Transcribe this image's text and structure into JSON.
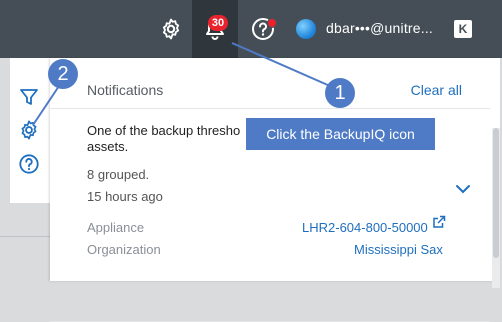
{
  "topbar": {
    "badge_count": "30",
    "user_name": "dbar•••@unitre...",
    "logo_text": "K"
  },
  "panel": {
    "title": "Notifications",
    "clear_all": "Clear all"
  },
  "notification": {
    "message": "One of the backup thresho assets.",
    "grouped": "8 grouped.",
    "time": "15 hours ago",
    "appliance_label": "Appliance",
    "appliance_value": "LHR2-604-800-50000",
    "organization_label": "Organization",
    "organization_value": "Mississippi Sax"
  },
  "annotations": {
    "tooltip": "Click the BackupIQ icon",
    "callout_1": "1",
    "callout_2": "2"
  },
  "colors": {
    "topbar": "#454e56",
    "badge": "#e8232d",
    "link": "#1f6fbf",
    "callout": "#4f7bc6"
  }
}
